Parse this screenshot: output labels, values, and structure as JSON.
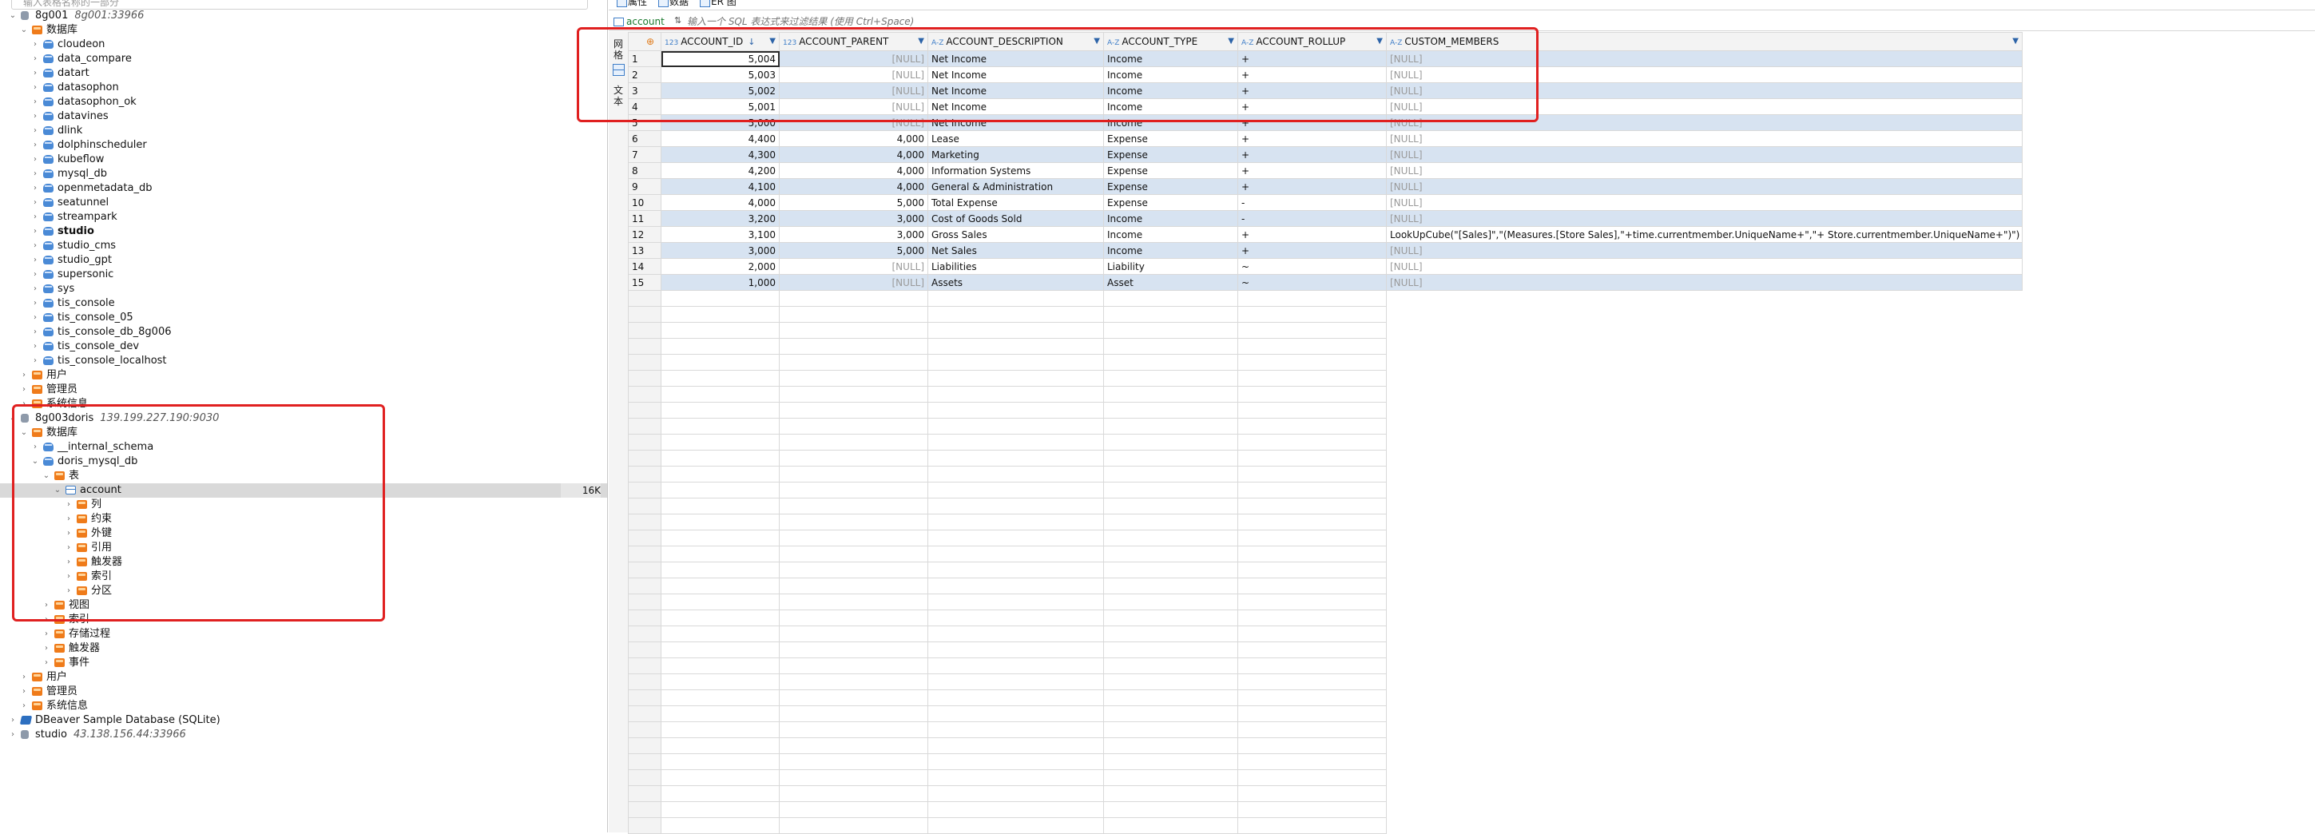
{
  "navigator": {
    "search_placeholder": "输入表格名称的一部分",
    "tree": [
      {
        "label": "8g001",
        "sub": "8g001:33966",
        "icon": "conn",
        "arrow": "v",
        "indent": 0
      },
      {
        "label": "数据库",
        "icon": "folder",
        "arrow": "v",
        "indent": 1
      },
      {
        "label": "cloudeon",
        "icon": "db",
        "arrow": ">",
        "indent": 2
      },
      {
        "label": "data_compare",
        "icon": "db",
        "arrow": ">",
        "indent": 2
      },
      {
        "label": "datart",
        "icon": "db",
        "arrow": ">",
        "indent": 2
      },
      {
        "label": "datasophon",
        "icon": "db",
        "arrow": ">",
        "indent": 2
      },
      {
        "label": "datasophon_ok",
        "icon": "db",
        "arrow": ">",
        "indent": 2
      },
      {
        "label": "datavines",
        "icon": "db",
        "arrow": ">",
        "indent": 2
      },
      {
        "label": "dlink",
        "icon": "db",
        "arrow": ">",
        "indent": 2
      },
      {
        "label": "dolphinscheduler",
        "icon": "db",
        "arrow": ">",
        "indent": 2
      },
      {
        "label": "kubeflow",
        "icon": "db",
        "arrow": ">",
        "indent": 2
      },
      {
        "label": "mysql_db",
        "icon": "db",
        "arrow": ">",
        "indent": 2
      },
      {
        "label": "openmetadata_db",
        "icon": "db",
        "arrow": ">",
        "indent": 2
      },
      {
        "label": "seatunnel",
        "icon": "db",
        "arrow": ">",
        "indent": 2
      },
      {
        "label": "streampark",
        "icon": "db",
        "arrow": ">",
        "indent": 2
      },
      {
        "label": "studio",
        "icon": "db",
        "arrow": ">",
        "indent": 2,
        "bold": true
      },
      {
        "label": "studio_cms",
        "icon": "db",
        "arrow": ">",
        "indent": 2
      },
      {
        "label": "studio_gpt",
        "icon": "db",
        "arrow": ">",
        "indent": 2
      },
      {
        "label": "supersonic",
        "icon": "db",
        "arrow": ">",
        "indent": 2
      },
      {
        "label": "sys",
        "icon": "db",
        "arrow": ">",
        "indent": 2
      },
      {
        "label": "tis_console",
        "icon": "db",
        "arrow": ">",
        "indent": 2
      },
      {
        "label": "tis_console_05",
        "icon": "db",
        "arrow": ">",
        "indent": 2
      },
      {
        "label": "tis_console_db_8g006",
        "icon": "db",
        "arrow": ">",
        "indent": 2
      },
      {
        "label": "tis_console_dev",
        "icon": "db",
        "arrow": ">",
        "indent": 2
      },
      {
        "label": "tis_console_localhost",
        "icon": "db",
        "arrow": ">",
        "indent": 2
      },
      {
        "label": "用户",
        "icon": "folder",
        "arrow": ">",
        "indent": 1
      },
      {
        "label": "管理员",
        "icon": "folder",
        "arrow": ">",
        "indent": 1
      },
      {
        "label": "系统信息",
        "icon": "folder",
        "arrow": ">",
        "indent": 1
      },
      {
        "label": "8g003doris",
        "sub": "139.199.227.190:9030",
        "icon": "conn",
        "arrow": "v",
        "indent": 0
      },
      {
        "label": "数据库",
        "icon": "folder",
        "arrow": "v",
        "indent": 1
      },
      {
        "label": "__internal_schema",
        "icon": "db",
        "arrow": ">",
        "indent": 2
      },
      {
        "label": "doris_mysql_db",
        "icon": "db",
        "arrow": "v",
        "indent": 2
      },
      {
        "label": "表",
        "icon": "folder",
        "arrow": "v",
        "indent": 3
      },
      {
        "label": "account",
        "icon": "table",
        "arrow": "v",
        "indent": 4,
        "selected": true,
        "size": "16K"
      },
      {
        "label": "列",
        "icon": "folder",
        "arrow": ">",
        "indent": 5
      },
      {
        "label": "约束",
        "icon": "folder",
        "arrow": ">",
        "indent": 5
      },
      {
        "label": "外键",
        "icon": "folder",
        "arrow": ">",
        "indent": 5
      },
      {
        "label": "引用",
        "icon": "folder",
        "arrow": ">",
        "indent": 5
      },
      {
        "label": "触发器",
        "icon": "folder",
        "arrow": ">",
        "indent": 5
      },
      {
        "label": "索引",
        "icon": "folder",
        "arrow": ">",
        "indent": 5
      },
      {
        "label": "分区",
        "icon": "folder",
        "arrow": ">",
        "indent": 5
      },
      {
        "label": "视图",
        "icon": "folder",
        "arrow": ">",
        "indent": 3
      },
      {
        "label": "索引",
        "icon": "folder",
        "arrow": ">",
        "indent": 3
      },
      {
        "label": "存储过程",
        "icon": "folder",
        "arrow": ">",
        "indent": 3
      },
      {
        "label": "触发器",
        "icon": "folder",
        "arrow": ">",
        "indent": 3
      },
      {
        "label": "事件",
        "icon": "folder",
        "arrow": ">",
        "indent": 3
      },
      {
        "label": "用户",
        "icon": "folder",
        "arrow": ">",
        "indent": 1
      },
      {
        "label": "管理员",
        "icon": "folder",
        "arrow": ">",
        "indent": 1
      },
      {
        "label": "系统信息",
        "icon": "folder",
        "arrow": ">",
        "indent": 1
      },
      {
        "label": "DBeaver Sample Database (SQLite)",
        "icon": "sqlite",
        "arrow": ">",
        "indent": 0
      },
      {
        "label": "studio",
        "sub": "43.138.156.44:33966",
        "icon": "conn",
        "arrow": ">",
        "indent": 0
      }
    ]
  },
  "editor": {
    "tabs": [
      "属性",
      "数据",
      "ER 图"
    ],
    "filter": {
      "table_label": "account",
      "placeholder": "输入一个 SQL 表达式来过滤结果 (使用 Ctrl+Space)"
    },
    "side_labels": [
      "网格",
      "文本"
    ],
    "grid": {
      "columns": [
        {
          "name": "ACCOUNT_ID",
          "type": "123",
          "sort": true
        },
        {
          "name": "ACCOUNT_PARENT",
          "type": "123"
        },
        {
          "name": "ACCOUNT_DESCRIPTION",
          "type": "A-Z"
        },
        {
          "name": "ACCOUNT_TYPE",
          "type": "A-Z"
        },
        {
          "name": "ACCOUNT_ROLLUP",
          "type": "A-Z"
        },
        {
          "name": "CUSTOM_MEMBERS",
          "type": "A-Z"
        }
      ],
      "null_text": "[NULL]",
      "rows": [
        [
          "5,004",
          null,
          "Net Income",
          "Income",
          "+",
          null
        ],
        [
          "5,003",
          null,
          "Net Income",
          "Income",
          "+",
          null
        ],
        [
          "5,002",
          null,
          "Net Income",
          "Income",
          "+",
          null
        ],
        [
          "5,001",
          null,
          "Net Income",
          "Income",
          "+",
          null
        ],
        [
          "5,000",
          null,
          "Net Income",
          "Income",
          "+",
          null
        ],
        [
          "4,400",
          "4,000",
          "Lease",
          "Expense",
          "+",
          null
        ],
        [
          "4,300",
          "4,000",
          "Marketing",
          "Expense",
          "+",
          null
        ],
        [
          "4,200",
          "4,000",
          "Information Systems",
          "Expense",
          "+",
          null
        ],
        [
          "4,100",
          "4,000",
          "General & Administration",
          "Expense",
          "+",
          null
        ],
        [
          "4,000",
          "5,000",
          "Total Expense",
          "Expense",
          "-",
          null
        ],
        [
          "3,200",
          "3,000",
          "Cost of Goods Sold",
          "Income",
          "-",
          null
        ],
        [
          "3,100",
          "3,000",
          "Gross Sales",
          "Income",
          "+",
          "LookUpCube(\"[Sales]\",\"(Measures.[Store Sales],\"+time.currentmember.UniqueName+\",\"+ Store.currentmember.UniqueName+\")\")"
        ],
        [
          "3,000",
          "5,000",
          "Net Sales",
          "Income",
          "+",
          null
        ],
        [
          "2,000",
          null,
          "Liabilities",
          "Liability",
          "~",
          null
        ],
        [
          "1,000",
          null,
          "Assets",
          "Asset",
          "~",
          null
        ]
      ]
    }
  },
  "colors": {
    "highlight": "#e02020",
    "row_alt": "#d7e3f1",
    "folder": "#ef7b1a",
    "database": "#4a8ad6"
  }
}
